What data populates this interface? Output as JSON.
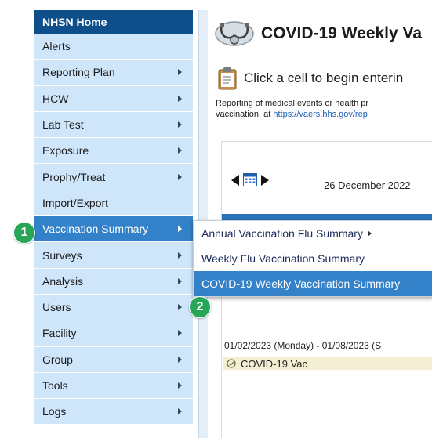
{
  "nav": {
    "home": "NHSN Home",
    "items": [
      {
        "label": "Alerts",
        "arrow": false
      },
      {
        "label": "Reporting Plan",
        "arrow": true
      },
      {
        "label": "HCW",
        "arrow": true
      },
      {
        "label": "Lab Test",
        "arrow": true
      },
      {
        "label": "Exposure",
        "arrow": true
      },
      {
        "label": "Prophy/Treat",
        "arrow": true
      },
      {
        "label": "Import/Export",
        "arrow": false
      },
      {
        "label": "Vaccination Summary",
        "arrow": true,
        "active": true
      },
      {
        "label": "Surveys",
        "arrow": true
      },
      {
        "label": "Analysis",
        "arrow": true
      },
      {
        "label": "Users",
        "arrow": true
      },
      {
        "label": "Facility",
        "arrow": true
      },
      {
        "label": "Group",
        "arrow": true
      },
      {
        "label": "Tools",
        "arrow": true
      },
      {
        "label": "Logs",
        "arrow": true
      }
    ]
  },
  "submenu": {
    "items": [
      {
        "label": "Annual Vaccination Flu Summary",
        "has_submenu": true
      },
      {
        "label": "Weekly Flu Vaccination Summary"
      },
      {
        "label": "COVID-19 Weekly Vaccination Summary",
        "selected": true
      }
    ]
  },
  "page": {
    "title": "COVID-19 Weekly Va",
    "instruction": "Click a cell to begin enterin",
    "reporting_note_line1": "Reporting of medical events or health pr",
    "reporting_note_line2_prefix": "vaccination, at ",
    "reporting_link": "https://vaers.hhs.gov/rep"
  },
  "calendar": {
    "week_date": "26 December 2022",
    "range": "01/02/2023 (Monday) - 01/08/2023 (S",
    "row_label": "COVID-19 Vac"
  },
  "badges": {
    "step1": "1",
    "step2": "2"
  },
  "colors": {
    "nav_home": "#0e4f8b",
    "nav_item": "#cfe6fa",
    "nav_active": "#3381c9",
    "submenu_selected": "#3381c9",
    "badge": "#27a658",
    "row_highlight": "#f4efd4"
  }
}
